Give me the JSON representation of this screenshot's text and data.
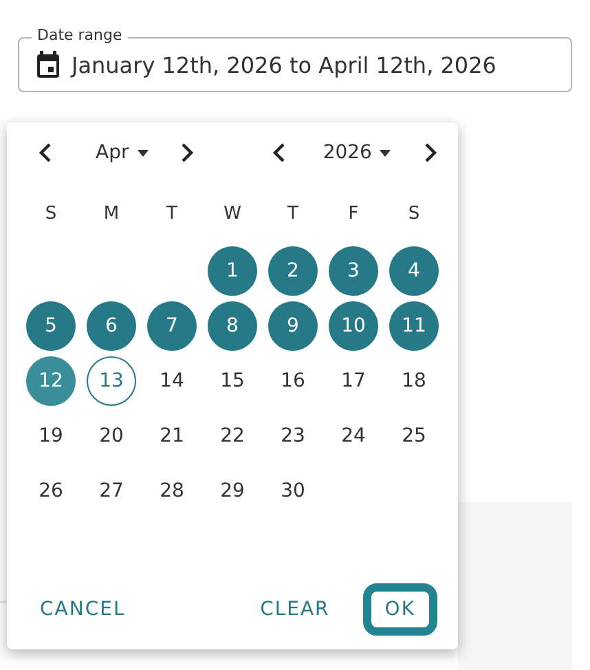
{
  "date_field": {
    "label": "Date range",
    "value": "January 12th, 2026 to April 12th, 2026"
  },
  "picker": {
    "month": "Apr",
    "year": "2026",
    "weekdays": [
      "S",
      "M",
      "T",
      "W",
      "T",
      "F",
      "S"
    ],
    "days": [
      {
        "kind": "blank"
      },
      {
        "kind": "blank"
      },
      {
        "kind": "blank"
      },
      {
        "label": "1",
        "kind": "in-range"
      },
      {
        "label": "2",
        "kind": "in-range"
      },
      {
        "label": "3",
        "kind": "in-range"
      },
      {
        "label": "4",
        "kind": "in-range"
      },
      {
        "label": "5",
        "kind": "in-range"
      },
      {
        "label": "6",
        "kind": "in-range"
      },
      {
        "label": "7",
        "kind": "in-range"
      },
      {
        "label": "8",
        "kind": "in-range"
      },
      {
        "label": "9",
        "kind": "in-range"
      },
      {
        "label": "10",
        "kind": "in-range"
      },
      {
        "label": "11",
        "kind": "in-range"
      },
      {
        "label": "12",
        "kind": "range-end"
      },
      {
        "label": "13",
        "kind": "today"
      },
      {
        "label": "14",
        "kind": "plain"
      },
      {
        "label": "15",
        "kind": "plain"
      },
      {
        "label": "16",
        "kind": "plain"
      },
      {
        "label": "17",
        "kind": "plain"
      },
      {
        "label": "18",
        "kind": "plain"
      },
      {
        "label": "19",
        "kind": "plain"
      },
      {
        "label": "20",
        "kind": "plain"
      },
      {
        "label": "21",
        "kind": "plain"
      },
      {
        "label": "22",
        "kind": "plain"
      },
      {
        "label": "23",
        "kind": "plain"
      },
      {
        "label": "24",
        "kind": "plain"
      },
      {
        "label": "25",
        "kind": "plain"
      },
      {
        "label": "26",
        "kind": "plain"
      },
      {
        "label": "27",
        "kind": "plain"
      },
      {
        "label": "28",
        "kind": "plain"
      },
      {
        "label": "29",
        "kind": "plain"
      },
      {
        "label": "30",
        "kind": "plain"
      }
    ],
    "buttons": [
      {
        "label": "CANCEL",
        "focused": false
      },
      {
        "label": "CLEAR",
        "focused": false
      },
      {
        "label": "OK",
        "focused": true
      }
    ]
  }
}
